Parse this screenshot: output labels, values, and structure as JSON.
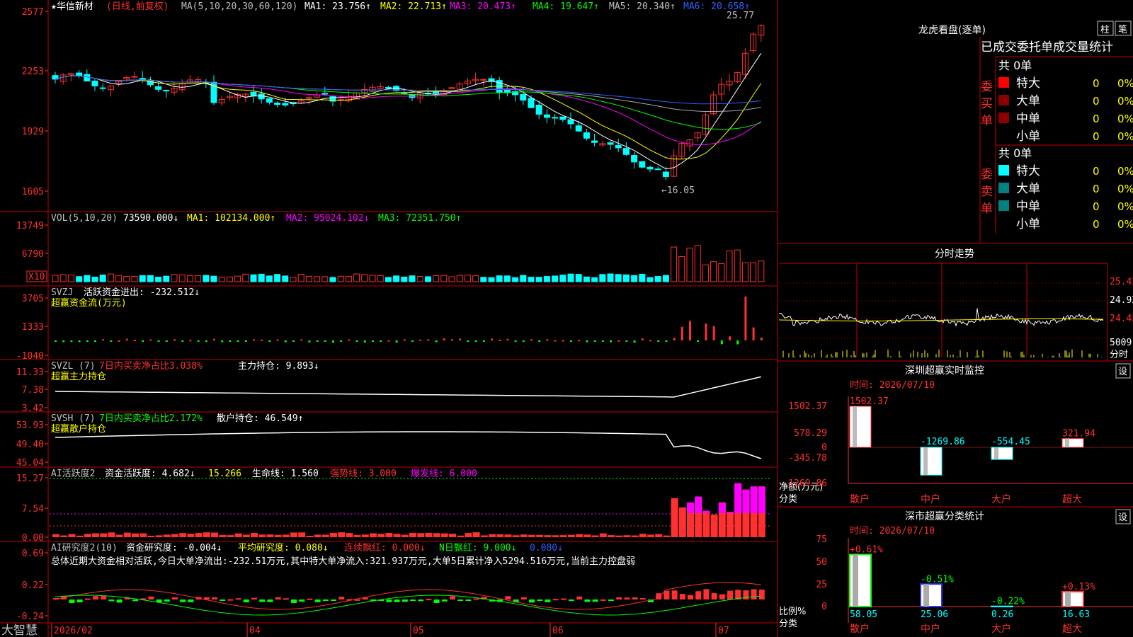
{
  "colors": {
    "red": "#ff3030",
    "cyan": "#00ffff",
    "white": "#ffffff",
    "yellow": "#ffff00",
    "magenta": "#ff00ff",
    "green": "#00ff00",
    "blue": "#3060ff",
    "frame": "#c00000",
    "gray": "#c0c0c0"
  },
  "price_panel": {
    "stock_name": "★华信新材",
    "mode": "(日线,前复权)",
    "ma_label": "MA(5,10,20,30,60,120)",
    "ma1": "MA1: 23.756↑",
    "ma2": "MA2: 22.713↑",
    "ma3": "MA3: 20.473↑",
    "ma4": "MA4: 19.647↑",
    "ma5": "MA5: 20.340↑",
    "ma6": "MA6: 20.658↑",
    "high_mark": "25.77",
    "low_mark": "←16.05",
    "y_ticks": [
      "2577",
      "2253",
      "1929",
      "1605"
    ]
  },
  "vol_panel": {
    "label": "VOL(5,10,20)",
    "vol": "73590.000↓",
    "ma1": "MA1: 102134.000↑",
    "ma2": "MA2: 95024.102↓",
    "ma3": "MA3: 72351.750↑",
    "y_ticks": [
      "13749",
      "6790"
    ],
    "unit": "X10"
  },
  "svzj_panel": {
    "label": "SVZJ",
    "value": "活跃资金进出: -232.512↓",
    "sub": "超赢资金流(万元)",
    "y_ticks": [
      "3705",
      "1333",
      "-1040"
    ]
  },
  "svzl_panel": {
    "label": "SVZL (7)",
    "ratio": "7日内买卖净占比3.038%",
    "hold": "主力持仓: 9.893↓",
    "sub": "超赢主力持仓",
    "y_ticks": [
      "11.33",
      "7.38",
      "3.42"
    ]
  },
  "svsh_panel": {
    "label": "SVSH (7)",
    "ratio": "7日内买卖净占比2.172%",
    "hold": "散户持仓: 46.549↑",
    "sub": "超赢散户持仓",
    "y_ticks": [
      "53.93",
      "49.40",
      "45.04"
    ]
  },
  "ai2_panel": {
    "label": "AI活跃度2",
    "v1": "资金活跃度: 4.682↓",
    "v2": "15.266",
    "v3": "生命线: 1.560",
    "v4": "强势线: 3.000",
    "v5": "爆发线: 6.000",
    "y_ticks": [
      "15.27",
      "7.54",
      "0.00"
    ]
  },
  "ai_research_panel": {
    "label": "AI研究度2(10)",
    "v1": "资金研究度: -0.004↓",
    "v2": "平均研究度: 0.080↓",
    "v3": "连续飘红: 0.000↓",
    "v4": "N日飘红: 9.000↓",
    "v5": "0.080↓",
    "summary": "总体近期大资金相对活跃,今日大单净流出:-232.51万元,其中特大单净流入:321.937万元,大单5日累计净入5294.516万元,当前主力控盘弱",
    "y_ticks": [
      "0.69",
      "0.22",
      "-0.24"
    ]
  },
  "x_axis": {
    "labels": [
      "2026/02",
      "04",
      "05",
      "06",
      "07"
    ]
  },
  "logo": "大智慧",
  "right": {
    "dragon_title": "龙虎看盘(逐单)",
    "tab_zhu": "柱",
    "tab_bi": "笔",
    "header": "已成交委托单成交量统计",
    "buy_side": "委买单",
    "sell_side": "委卖单",
    "buy_total": "共 0单",
    "sell_total": "共 0单",
    "buy_rows": [
      {
        "name": "特大",
        "count": "0",
        "pct": "0%"
      },
      {
        "name": "大单",
        "count": "0",
        "pct": "0%"
      },
      {
        "name": "中单",
        "count": "0",
        "pct": "0%"
      },
      {
        "name": "小单",
        "count": "0",
        "pct": "0%"
      }
    ],
    "sell_rows": [
      {
        "name": "特大",
        "count": "0",
        "pct": "0%"
      },
      {
        "name": "大单",
        "count": "0",
        "pct": "0%"
      },
      {
        "name": "中单",
        "count": "0",
        "pct": "0%"
      },
      {
        "name": "小单",
        "count": "0",
        "pct": "0%"
      }
    ],
    "intraday_title": "分时走势",
    "intraday_ticks": [
      "25.42",
      "24.92",
      "24.42",
      "5009",
      "分时"
    ],
    "monitor_title": "深圳超赢实时监控",
    "monitor_set": "设",
    "monitor_time": "时间: 2026/07/10",
    "monitor_yticks": [
      "1502.37",
      "578.29",
      "0",
      "-345.78",
      "-1269.86"
    ],
    "monitor_ylabel": "净额(万元)",
    "monitor_xlabel": "分类",
    "monitor_bars": [
      {
        "cat": "散户",
        "value": "1502.37"
      },
      {
        "cat": "中户",
        "value": "-1269.86"
      },
      {
        "cat": "大户",
        "value": "-554.45"
      },
      {
        "cat": "超大",
        "value": "321.94"
      }
    ],
    "stat_title": "深市超赢分类统计",
    "stat_set": "设",
    "stat_time": "时间: 2026/07/10",
    "stat_yticks": [
      "75",
      "50",
      "25",
      "0"
    ],
    "stat_ylabel": "比例%",
    "stat_xlabel": "分类",
    "stat_bars": [
      {
        "cat": "散户",
        "pct": "+0.61%",
        "value": "58.05"
      },
      {
        "cat": "中户",
        "pct": "-0.51%",
        "value": "25.06"
      },
      {
        "cat": "大户",
        "pct": "-0.22%",
        "value": "0.26"
      },
      {
        "cat": "超大",
        "pct": "+0.13%",
        "value": "16.63"
      }
    ]
  }
}
